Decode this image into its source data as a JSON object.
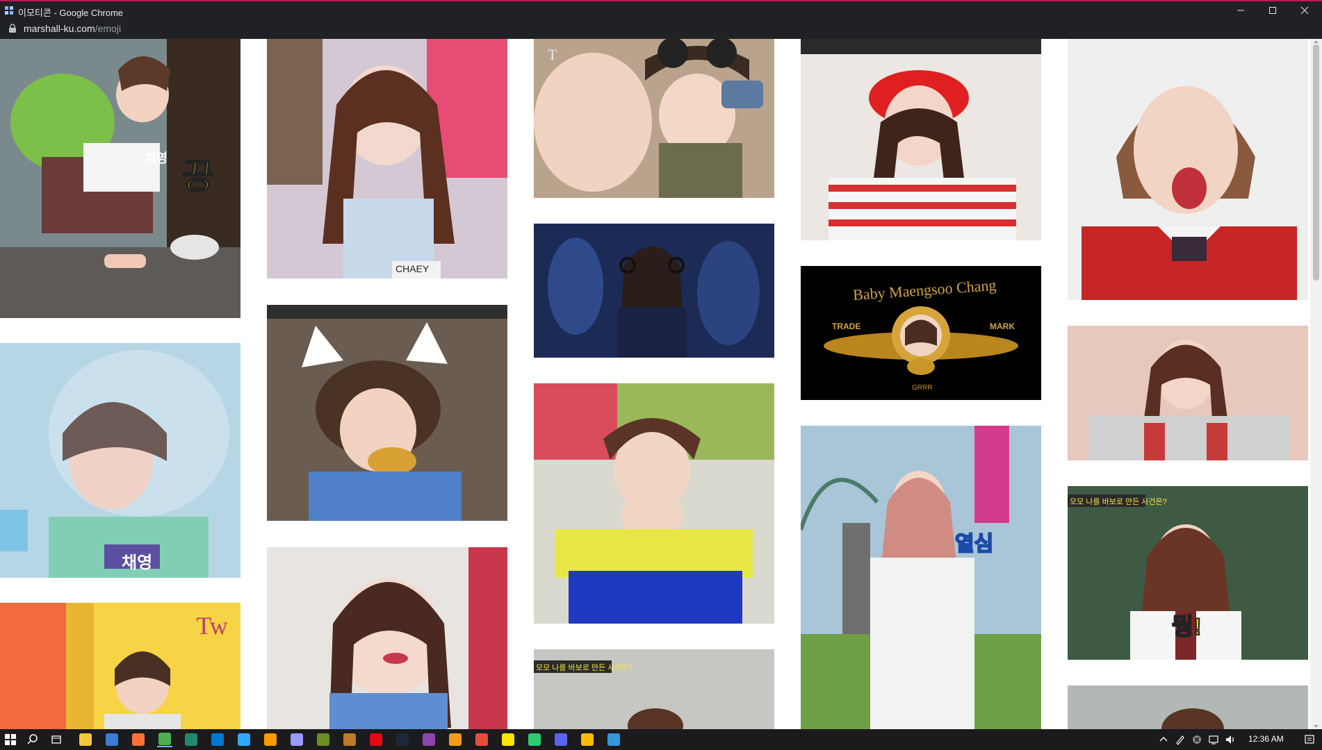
{
  "window": {
    "title": "이모티콘 - Google Chrome",
    "url_host": "marshall-ku.com",
    "url_path": "/emoji"
  },
  "gallery": {
    "columns": [
      {
        "tiles": [
          {
            "name": "chaeyoung-backpack-crawling-gif",
            "caption": "채영",
            "overlay_text": "끙",
            "bg": "#7a8a8c"
          },
          {
            "name": "sana-water-bubble-gif",
            "caption": "채영",
            "overlay_text": "",
            "bg": "#b6d6e6"
          },
          {
            "name": "jihyo-yellow-room-gif",
            "caption": "",
            "overlay_text": "",
            "bg": "#f6d445"
          }
        ]
      },
      {
        "tiles": [
          {
            "name": "chaeyoung-pigtails-gif",
            "caption": "CHAEY",
            "overlay_text": "",
            "bg": "#d4c8d4"
          },
          {
            "name": "jihyo-cat-ears-eating-gif",
            "caption": "",
            "overlay_text": "",
            "bg": "#6a5c50"
          },
          {
            "name": "chaeyoung-closeup-gif",
            "caption": "",
            "overlay_text": "",
            "bg": "#e8e4e2"
          }
        ]
      },
      {
        "tiles": [
          {
            "name": "nayeon-jeongyeon-laughing-car-gif",
            "caption": "",
            "overlay_text": "",
            "bg": "#b9a38d"
          },
          {
            "name": "chaeyoung-headphones-stage-gif",
            "caption": "",
            "overlay_text": "",
            "bg": "#1c2a56"
          },
          {
            "name": "dahyun-heart-hands-gif",
            "caption": "",
            "overlay_text": "",
            "bg": "#d9d9cf"
          },
          {
            "name": "momo-label-gif",
            "caption": "모모 나를 바보로 만든 사건은?",
            "overlay_text": "",
            "bg": "#c6c7c2"
          }
        ]
      },
      {
        "tiles": [
          {
            "name": "chaeyoung-red-beret-gif",
            "caption": "",
            "overlay_text": "",
            "bg": "#ece7e2"
          },
          {
            "name": "baby-maengsoo-chang-mgm-gif",
            "caption": "",
            "overlay_text": "",
            "bg": "#000000",
            "text_top": "Baby Maengsoo Chang",
            "text_left": "TRADE",
            "text_right": "MARK",
            "text_bottom": "GRRR"
          },
          {
            "name": "jihyo-thumbs-up-park-gif",
            "caption": "",
            "overlay_text": "열심",
            "bg": "#a9c6d8"
          }
        ]
      },
      {
        "tiles": [
          {
            "name": "jeongyeon-red-uniform-gif",
            "caption": "",
            "overlay_text": "",
            "bg": "#efefef"
          },
          {
            "name": "tzuyu-pointing-gif",
            "caption": "",
            "overlay_text": "",
            "bg": "#e6c8bc"
          },
          {
            "name": "momo-chalkboard-gif",
            "caption": "모모 나를 바보로 만든 사건은?",
            "overlay_text": "뭥!",
            "bg": "#3e5a44"
          },
          {
            "name": "partial-bottom-gif",
            "caption": "",
            "overlay_text": "",
            "bg": "#b2b8b6"
          }
        ]
      }
    ]
  },
  "taskbar": {
    "apps": [
      {
        "name": "file-explorer-icon",
        "color": "#f3c93c"
      },
      {
        "name": "firefox-dev-icon",
        "color": "#3a7bd5"
      },
      {
        "name": "firefox-icon",
        "color": "#ff7139"
      },
      {
        "name": "chrome-icon",
        "color": "#4caf50",
        "active": true
      },
      {
        "name": "gitkraken-icon",
        "color": "#1f8a70"
      },
      {
        "name": "vscode-icon",
        "color": "#0078d4"
      },
      {
        "name": "photoshop-icon",
        "color": "#31a8ff"
      },
      {
        "name": "illustrator-icon",
        "color": "#ff9a00"
      },
      {
        "name": "after-effects-icon",
        "color": "#9999ff"
      },
      {
        "name": "minecraft-icon",
        "color": "#6b8e23"
      },
      {
        "name": "app-tile-icon",
        "color": "#c07a2a"
      },
      {
        "name": "netflix-like-icon",
        "color": "#e50914"
      },
      {
        "name": "steam-icon",
        "color": "#1b2838"
      },
      {
        "name": "network-icon",
        "color": "#8e44ad"
      },
      {
        "name": "chart-app-icon",
        "color": "#f39c12"
      },
      {
        "name": "red-app-icon",
        "color": "#e74c3c"
      },
      {
        "name": "kakaotalk-icon",
        "color": "#fee500"
      },
      {
        "name": "green-app-icon",
        "color": "#2ecc71"
      },
      {
        "name": "discord-icon",
        "color": "#5865f2"
      },
      {
        "name": "chrome-canary-icon",
        "color": "#fbbc05"
      },
      {
        "name": "blue-app-icon",
        "color": "#3498db"
      }
    ],
    "clock": "12:36 AM"
  }
}
